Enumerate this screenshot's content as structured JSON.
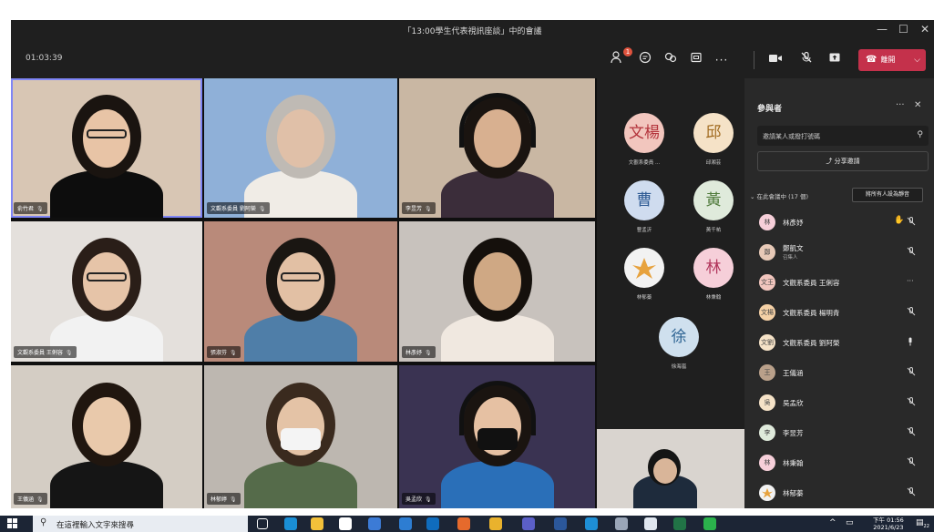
{
  "window": {
    "title": "「13:00學生代表視訊座談」中的會議",
    "minimize_glyph": "—",
    "maximize_glyph": "☐",
    "close_glyph": "✕"
  },
  "toolbar": {
    "timer": "01:03:39",
    "participants_badge": "1",
    "leave_label": "離開"
  },
  "video_tiles": [
    {
      "name": "俞竹君",
      "bg": "#d8c6b4"
    },
    {
      "name": "文觀系委員 劉阿榮",
      "bg": "#8fb0d8"
    },
    {
      "name": "李昱芳",
      "bg": "#c9b7a3"
    },
    {
      "name": "文觀系委員 王俐容",
      "bg": "#e4e0dc"
    },
    {
      "name": "張淑芬",
      "bg": "#b98a7a"
    },
    {
      "name": "林彥妤",
      "bg": "#c8c2bd"
    },
    {
      "name": "王儀涵",
      "bg": "#d4cdc4"
    },
    {
      "name": "林郁婷",
      "bg": "#bdb7b0"
    },
    {
      "name": "吳孟欣",
      "bg": "#3a3352"
    },
    {
      "name": "",
      "bg": "#d9d4cf"
    }
  ],
  "avatar_grid": [
    {
      "initials": "文楊",
      "name": "文觀系委員 ...",
      "color": "#f2c6be",
      "text_color": "#b3333b"
    },
    {
      "initials": "邱",
      "name": "邱湘芸",
      "color": "#f5e2c7",
      "text_color": "#a16a1f"
    },
    {
      "initials": "曹",
      "name": "曹孟沂",
      "color": "#cfdcef",
      "text_color": "#2f5b94"
    },
    {
      "initials": "黃",
      "name": "黃千祐",
      "color": "#dfeadb",
      "text_color": "#4f7a3b"
    },
    {
      "initials": "",
      "name": "林郁蓁",
      "color": "#f2f2f2",
      "text_color": "#e7a23d"
    },
    {
      "initials": "林",
      "name": "林秉翰",
      "color": "#f6cfd9",
      "text_color": "#b2365c"
    },
    {
      "initials": "徐",
      "name": "徐海嵐",
      "color": "#cfe0ee",
      "text_color": "#2e6493"
    }
  ],
  "panel": {
    "title": "參與者",
    "more_glyph": "···",
    "close_glyph": "✕",
    "invite_placeholder": "邀請某人或撥打號碼",
    "share_invite_label": "分享邀請",
    "section_header": "在此會議中 (17 個)",
    "mute_all_label": "將所有人設為靜音",
    "participants": [
      {
        "name": "林彥妤",
        "avatar": "林",
        "avatar_color": "#f6cfd9",
        "hand": true,
        "status": "mic-off"
      },
      {
        "name": "鄭凱文",
        "role": "召集人",
        "avatar": "鄭",
        "avatar_color": "#e7c9b7",
        "status": "mic-off"
      },
      {
        "name": "文觀系委員 王俐容",
        "avatar": "文王",
        "avatar_color": "#f2c6be",
        "status": "more"
      },
      {
        "name": "文觀系委員 楊明青",
        "avatar": "文楊",
        "avatar_color": "#f5d1a6",
        "status": "mic-off"
      },
      {
        "name": "文觀系委員 劉阿榮",
        "avatar": "文劉",
        "avatar_color": "#f5e2c7",
        "status": "mic-on"
      },
      {
        "name": "王儀涵",
        "avatar": "王",
        "avatar_color": "#b9a08a",
        "status": "mic-off"
      },
      {
        "name": "吳孟欣",
        "avatar": "吳",
        "avatar_color": "#f5e2c7",
        "status": "mic-off"
      },
      {
        "name": "李昱芳",
        "avatar": "李",
        "avatar_color": "#dfeadb",
        "status": "mic-off"
      },
      {
        "name": "林秉翰",
        "avatar": "林",
        "avatar_color": "#f6cfd9",
        "status": "mic-off"
      },
      {
        "name": "林郁蓁",
        "avatar": "",
        "avatar_color": "#f2f2f2",
        "status": "mic-off"
      }
    ]
  },
  "taskbar": {
    "search_placeholder": "在這裡輸入文字來搜尋",
    "time": "下午 01:56",
    "date": "2021/6/23",
    "notif_count": "22"
  }
}
